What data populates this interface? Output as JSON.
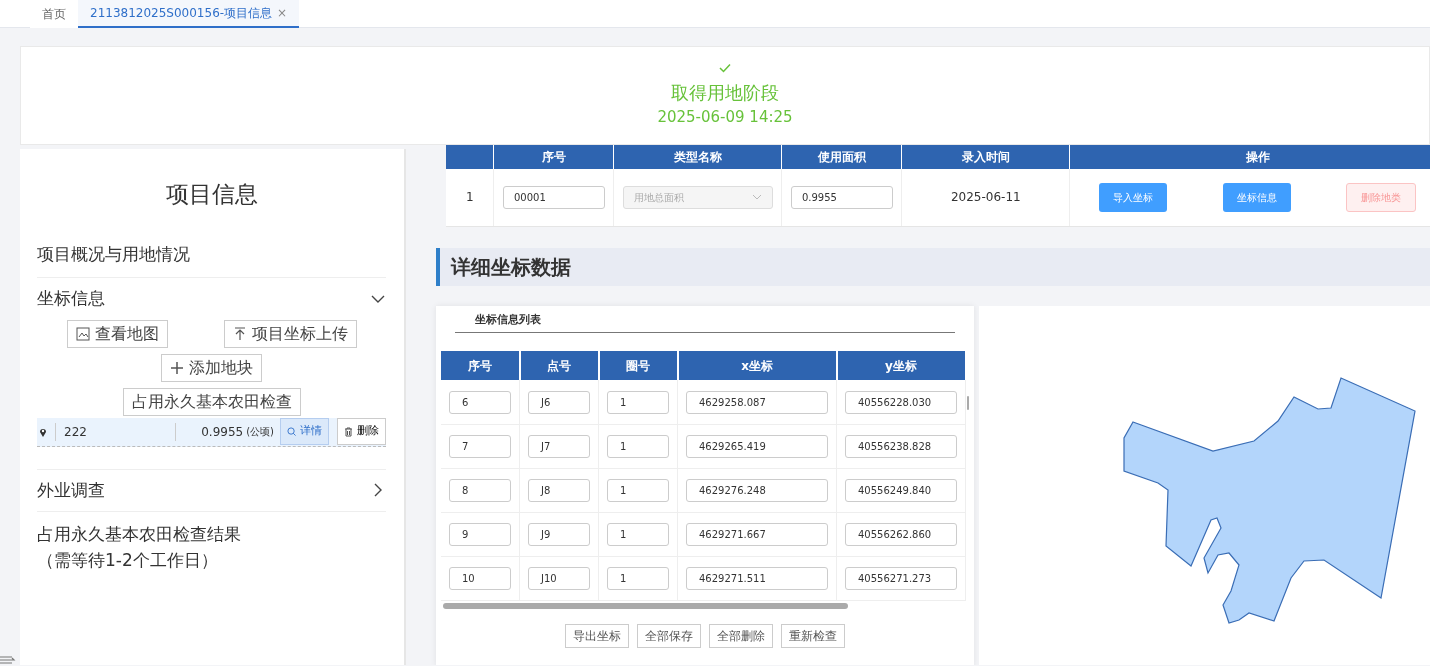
{
  "tabs": [
    {
      "label": "首页",
      "selected": false
    },
    {
      "label": "2113812025S000156-项目信息",
      "selected": true,
      "close": "×"
    }
  ],
  "stage": {
    "title": "取得用地阶段",
    "time": "2025-06-09 14:25",
    "done": true
  },
  "sidebar": {
    "title": "项目信息",
    "sections": [
      {
        "label": "项目概况与用地情况",
        "kind": "plain"
      },
      {
        "label": "坐标信息",
        "kind": "accordion",
        "expanded": true,
        "buttons": [
          {
            "label": "查看地图"
          },
          {
            "label": "项目坐标上传"
          },
          {
            "label": "添加地块"
          },
          {
            "label": "占用永久基本农田检查"
          }
        ],
        "parcels": [
          {
            "name": "222",
            "area": "0.9955",
            "unit": "(公顷)",
            "detail": "详情",
            "delete": "删除",
            "selected": true
          }
        ]
      },
      {
        "label": "外业调查",
        "kind": "accordion",
        "expanded": false
      },
      {
        "lines": [
          "占用永久基本农田检查结果",
          "（需等待1-2个工作日）"
        ],
        "kind": "note"
      }
    ]
  },
  "land_table": {
    "columns": [
      "",
      "序号",
      "类型名称",
      "使用面积",
      "录入时间",
      "操作"
    ],
    "rows": [
      {
        "index": "1",
        "code": "00001",
        "type_placeholder": "用地总面积",
        "area": "0.9955",
        "date": "2025-06-11",
        "actions": [
          {
            "label": "导入坐标",
            "kind": "primary"
          },
          {
            "label": "坐标信息",
            "kind": "primary"
          },
          {
            "label": "删除地类",
            "kind": "danger-disabled"
          }
        ]
      }
    ]
  },
  "section_title": "详细坐标数据",
  "coord_card": {
    "title": "坐标信息列表",
    "columns": [
      "序号",
      "点号",
      "圈号",
      "x坐标",
      "y坐标"
    ],
    "rows": [
      [
        "6",
        "J6",
        "1",
        "4629258.087",
        "40556228.030"
      ],
      [
        "7",
        "J7",
        "1",
        "4629265.419",
        "40556238.828"
      ],
      [
        "8",
        "J8",
        "1",
        "4629276.248",
        "40556249.840"
      ],
      [
        "9",
        "J9",
        "1",
        "4629271.667",
        "40556262.860"
      ],
      [
        "10",
        "J10",
        "1",
        "4629271.511",
        "40556271.273"
      ]
    ],
    "buttons": [
      "导出坐标",
      "全部保存",
      "全部删除",
      "重新检查"
    ]
  }
}
